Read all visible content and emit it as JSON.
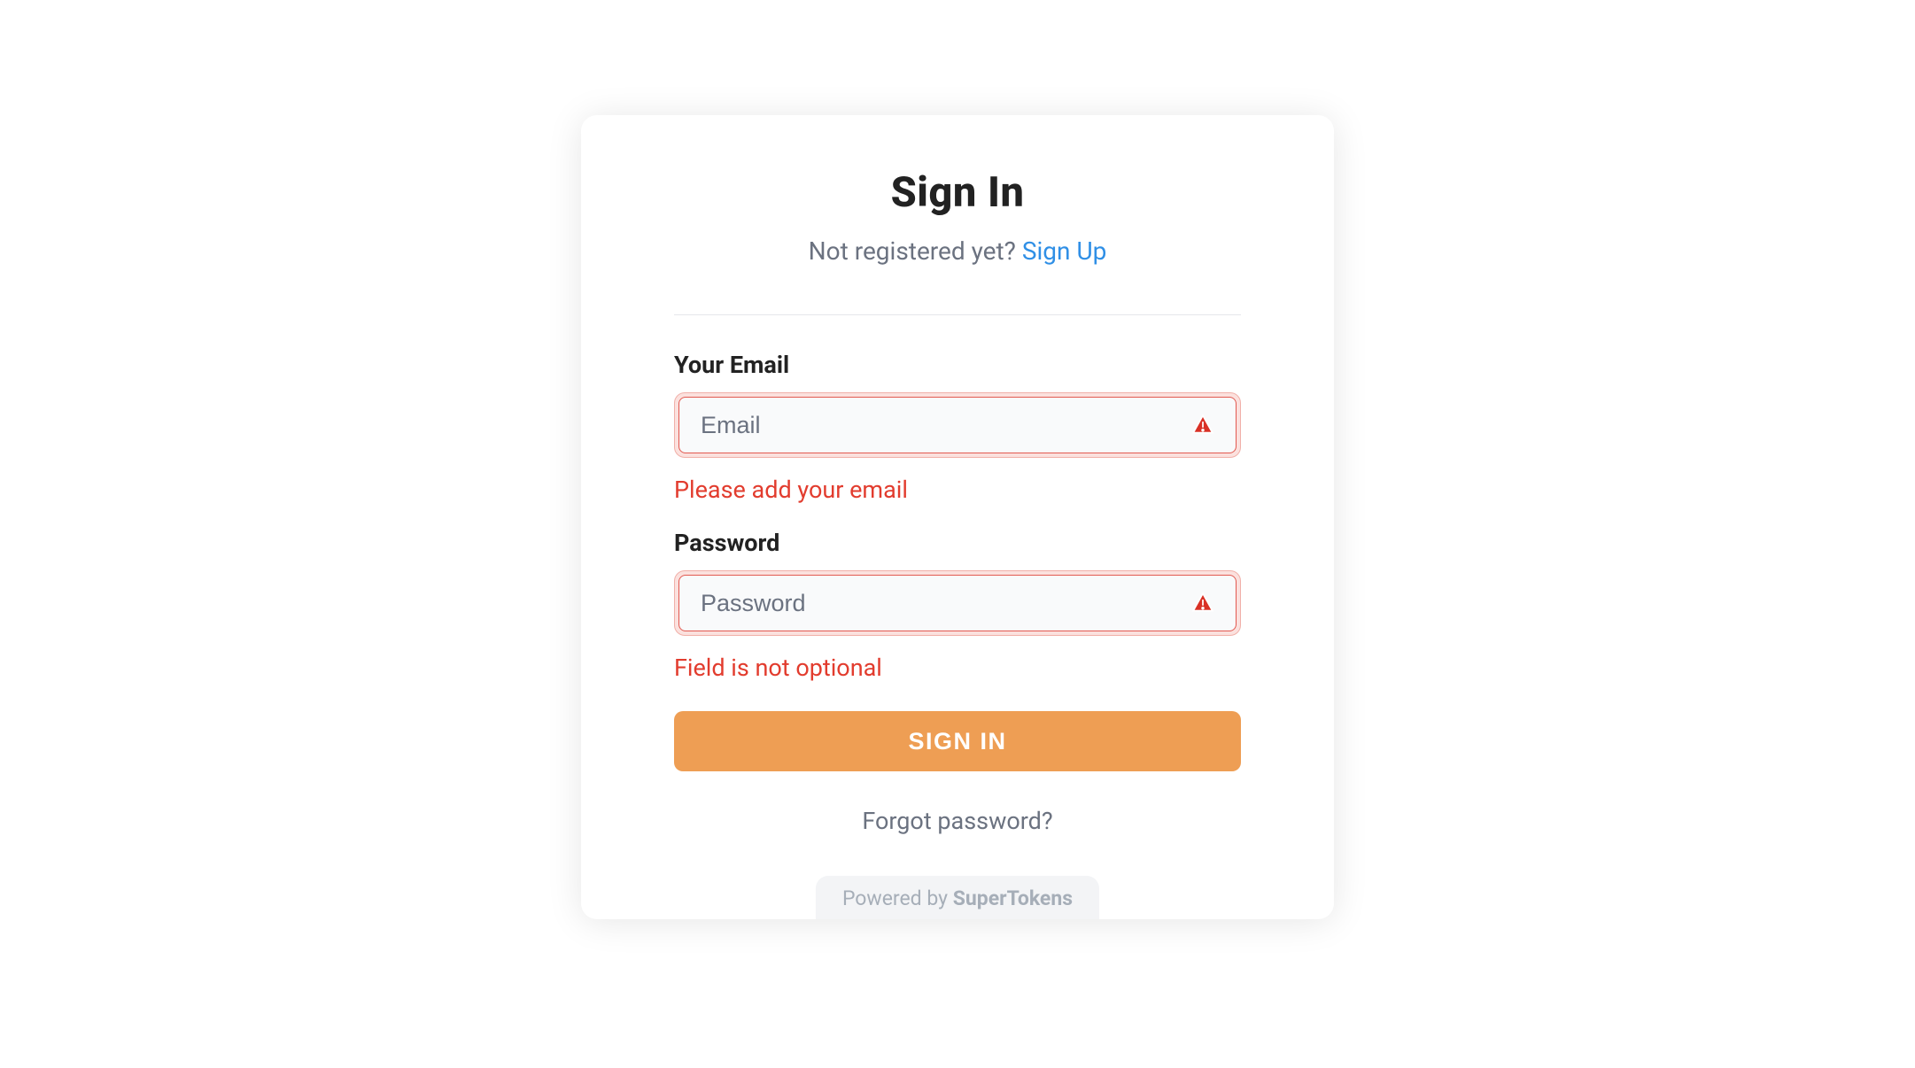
{
  "header": {
    "title": "Sign In",
    "subtext": "Not registered yet?",
    "signup_link": "Sign Up"
  },
  "fields": {
    "email": {
      "label": "Your Email",
      "placeholder": "Email",
      "value": "",
      "error": "Please add your email"
    },
    "password": {
      "label": "Password",
      "placeholder": "Password",
      "value": "",
      "error": "Field is not optional"
    }
  },
  "buttons": {
    "signin": "SIGN IN"
  },
  "links": {
    "forgot": "Forgot password?"
  },
  "footer": {
    "prefix": "Powered by ",
    "brand": "SuperTokens"
  },
  "colors": {
    "primary_button": "#ee9e54",
    "error": "#e23c2e",
    "link": "#2f8fe6"
  }
}
